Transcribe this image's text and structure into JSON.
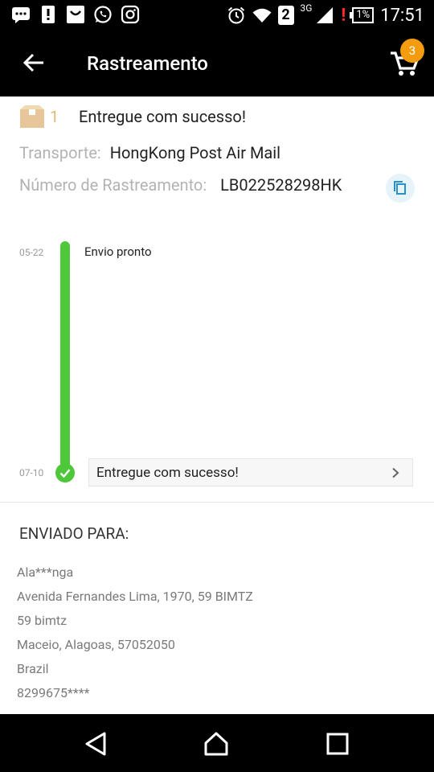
{
  "status_bar": {
    "sim_label": "2",
    "network_type": "3G",
    "alert": "!",
    "battery": "1%",
    "time": "17:51"
  },
  "app_bar": {
    "title": "Rastreamento",
    "cart_count": "3"
  },
  "package": {
    "number": "1",
    "status": "Entregue com sucesso!",
    "carrier_label": "Transporte:",
    "carrier_value": "HongKong Post Air Mail",
    "tracking_label": "Número de Rastreamento:",
    "tracking_value": "LB022528298HK"
  },
  "timeline": [
    {
      "date": "05-22",
      "text": "Envio pronto"
    },
    {
      "date": "07-10",
      "text": "Entregue com sucesso!"
    }
  ],
  "shipping": {
    "title": "ENVIADO PARA:",
    "lines": [
      "Ala***nga",
      "Avenida Fernandes Lima, 1970, 59 BIMTZ",
      "59 bimtz",
      "Maceio, Alagoas, 57052050",
      "Brazil",
      "8299675****"
    ]
  },
  "colors": {
    "app_bar_bg": "#000000",
    "accent_green": "#4ec73a",
    "cart_badge": "#f39c0f",
    "package_icon": "#e7c79a",
    "copy_icon": "#2a90c8"
  },
  "icons": [
    "sms-icon",
    "alert-icon",
    "messenger-icon",
    "whatsapp-icon",
    "instagram-icon",
    "alarm-icon",
    "wifi-icon",
    "signal-icon",
    "battery-icon",
    "back-arrow-icon",
    "cart-icon",
    "package-icon",
    "copy-icon",
    "check-icon",
    "chevron-right-icon",
    "nav-back-icon",
    "nav-home-icon",
    "nav-recents-icon"
  ]
}
